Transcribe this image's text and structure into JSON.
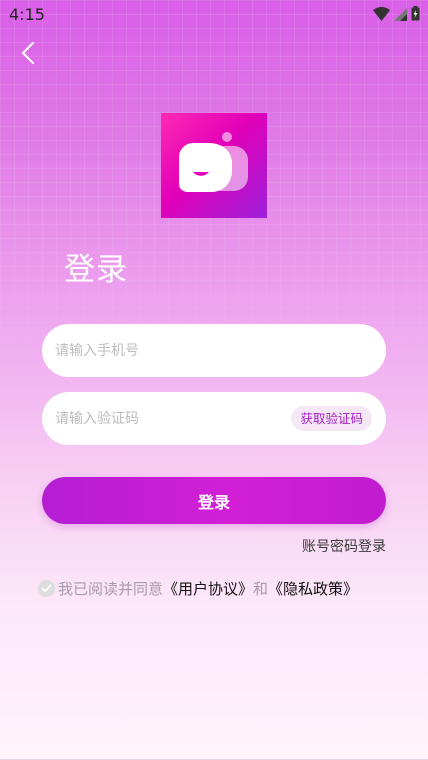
{
  "status_bar": {
    "time": "4:15",
    "icons": [
      "wifi-icon",
      "cell-signal-icon",
      "battery-icon"
    ]
  },
  "header": {
    "back_icon": "chevron-left-icon"
  },
  "logo": {
    "icon": "chat-bubble-logo",
    "colors": {
      "start": "#ff2ab4",
      "mid": "#e100b8",
      "end": "#9d1fd9"
    }
  },
  "title": "登录",
  "form": {
    "phone": {
      "value": "",
      "placeholder": "请输入手机号"
    },
    "code": {
      "value": "",
      "placeholder": "请输入验证码",
      "get_code_label": "获取验证码"
    },
    "submit_label": "登录",
    "password_login_label": "账号密码登录"
  },
  "agreement": {
    "checked": false,
    "prefix": "我已阅读并同意",
    "user_agreement": "《用户协议》",
    "and": "和",
    "privacy_policy": "《隐私政策》"
  },
  "colors": {
    "accent": "#c41fd4",
    "accent_text": "#a520c4",
    "placeholder": "#bdbdbd",
    "muted": "#a89aa6"
  }
}
